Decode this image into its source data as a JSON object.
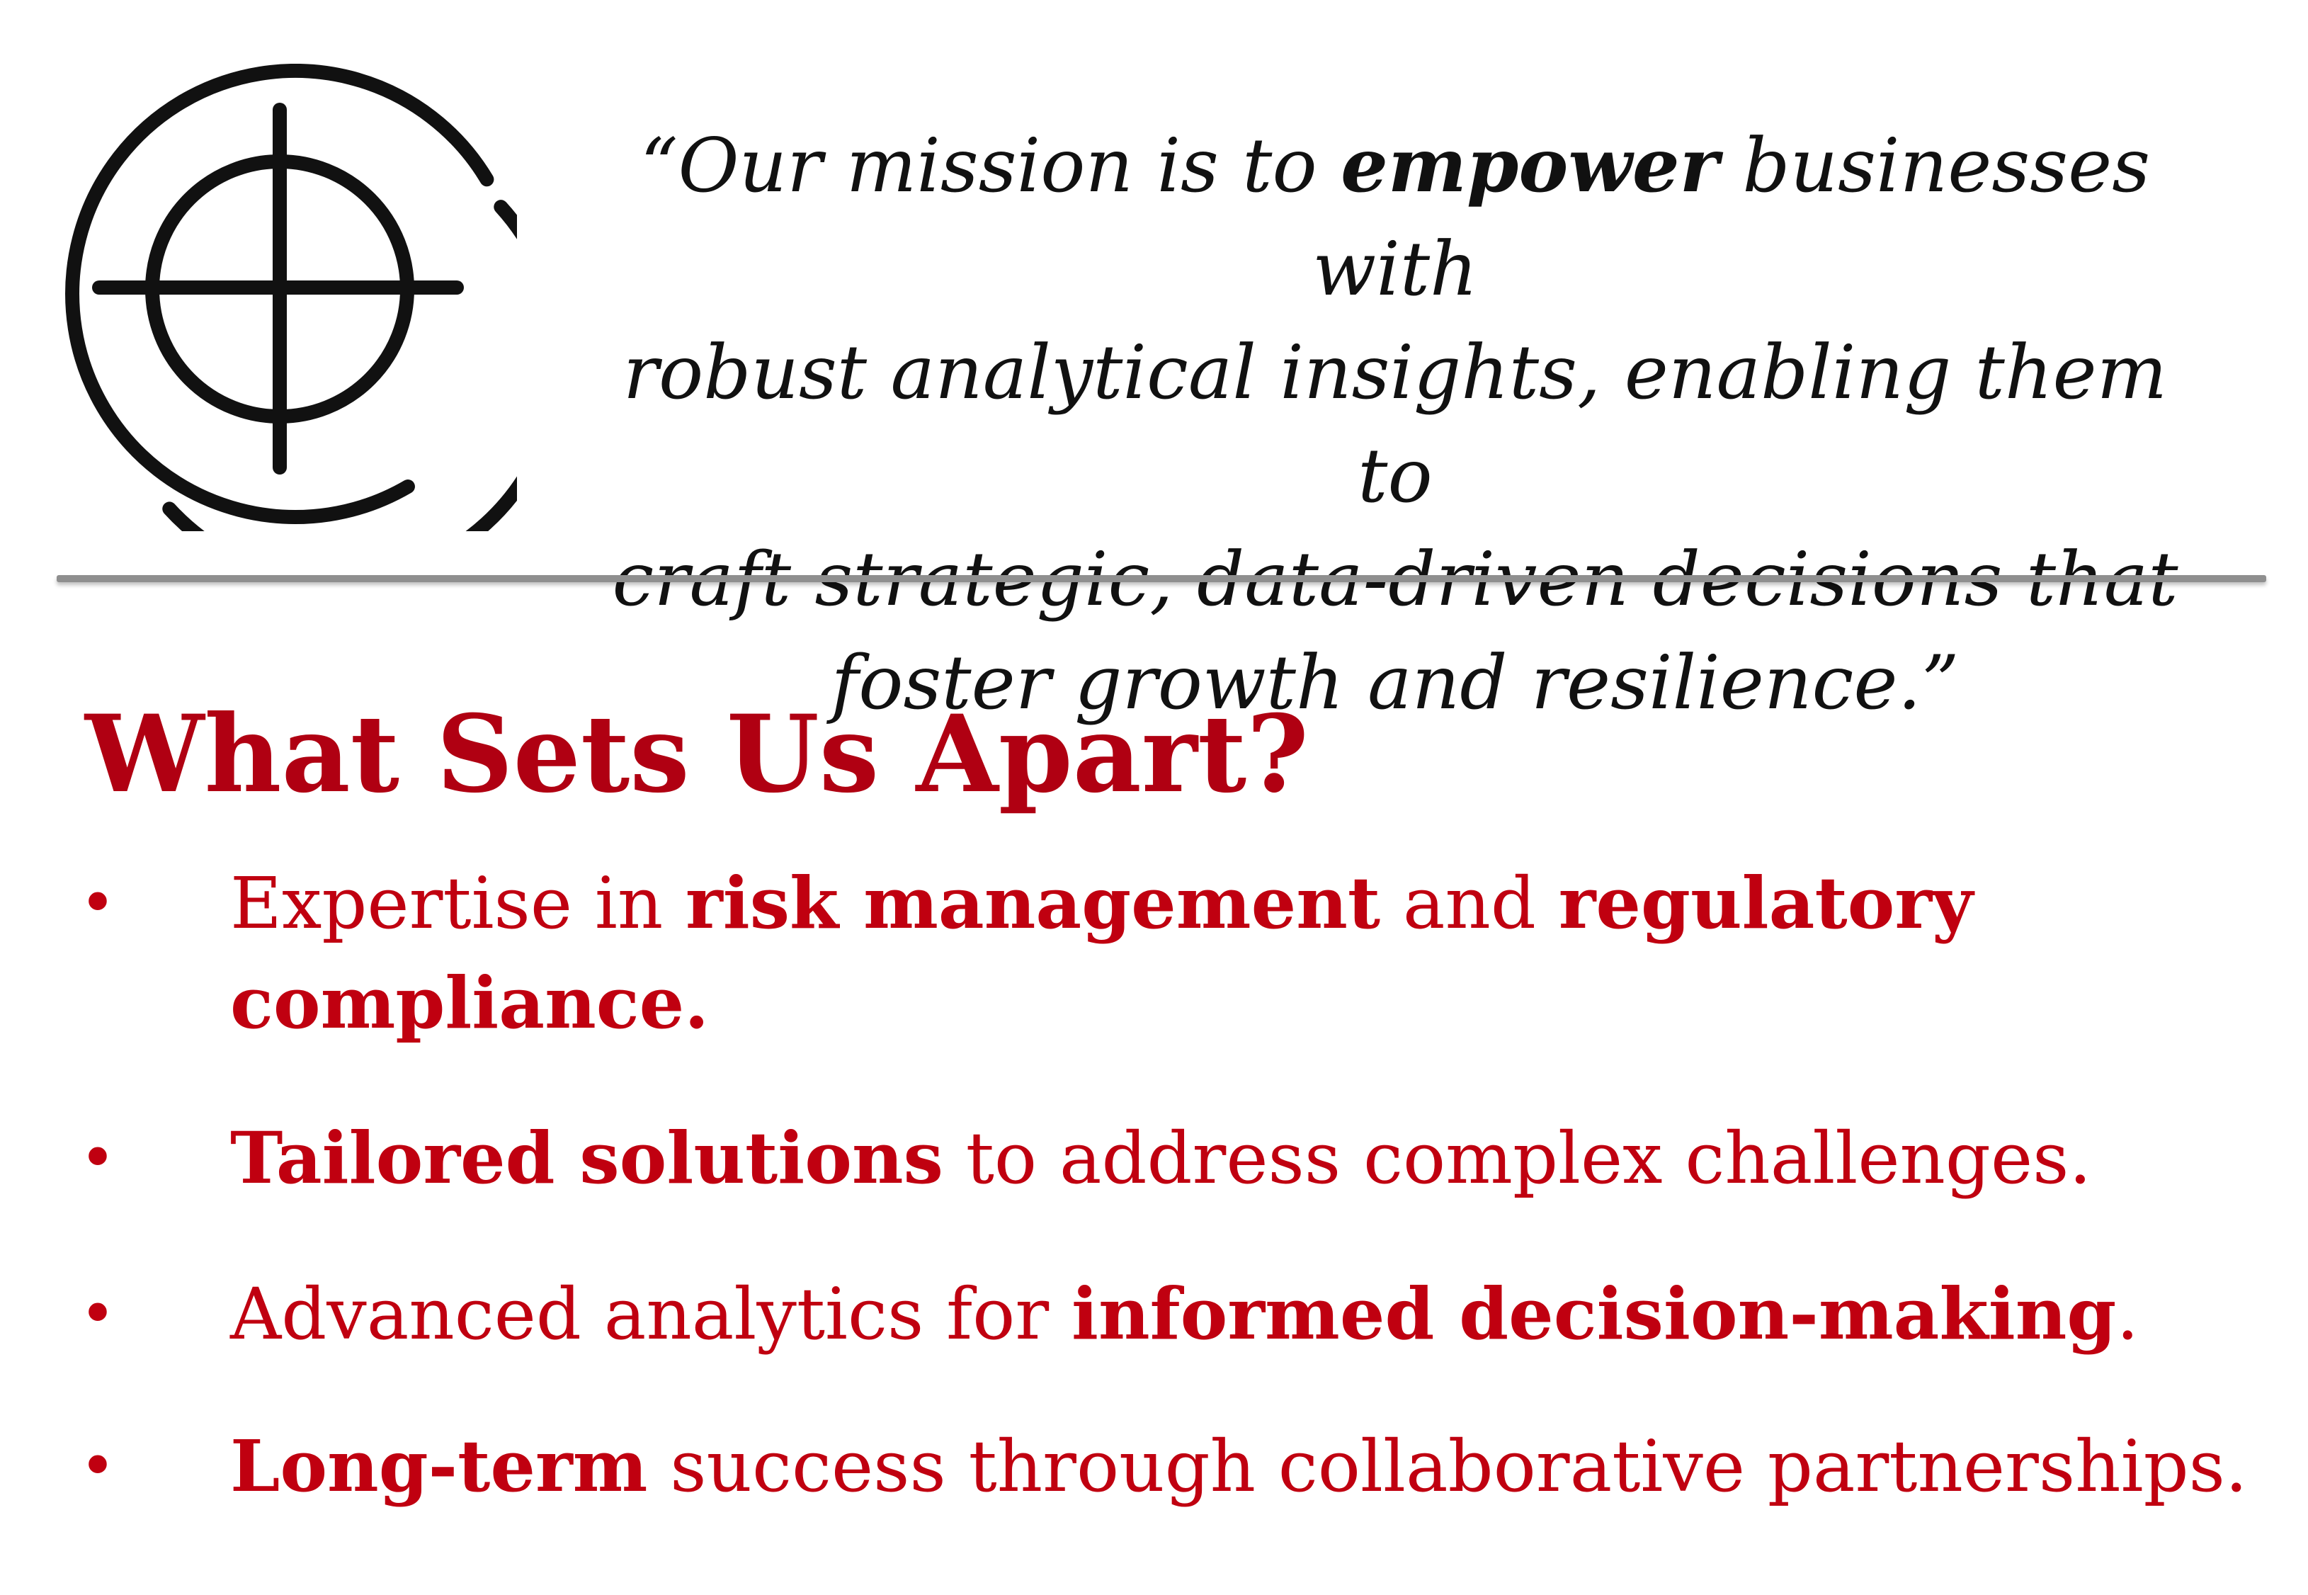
{
  "mission": {
    "line1_pre": "“Our mission is to ",
    "line1_bold": "empower",
    "line1_post": " businesses with",
    "line2": "robust analytical insights, enabling them to",
    "line3": "craft strategic, data-driven decisions that",
    "line4": "foster growth and resilience.”"
  },
  "heading": "What Sets Us Apart?",
  "bullets": [
    {
      "marker": "•",
      "b1_pre": "Expertise in ",
      "b1_bold1": "risk management",
      "b1_mid": " and ",
      "b1_bold2": "regulatory",
      "b1_bold3": "compliance."
    },
    {
      "marker": "•",
      "bold": "Tailored solutions",
      "post": " to address complex challenges."
    },
    {
      "marker": "•",
      "pre": "Advanced analytics for ",
      "bold": "informed decision-making",
      "post": "."
    },
    {
      "marker": "•",
      "bold": "Long-term",
      "post": " success through collaborative partnerships."
    }
  ],
  "colors": {
    "accent_red": "#c00010",
    "heading_red": "#b00012",
    "divider": "#8f8f8f",
    "text": "#111111"
  },
  "icons": {
    "logo": "crosshair-target-icon"
  }
}
